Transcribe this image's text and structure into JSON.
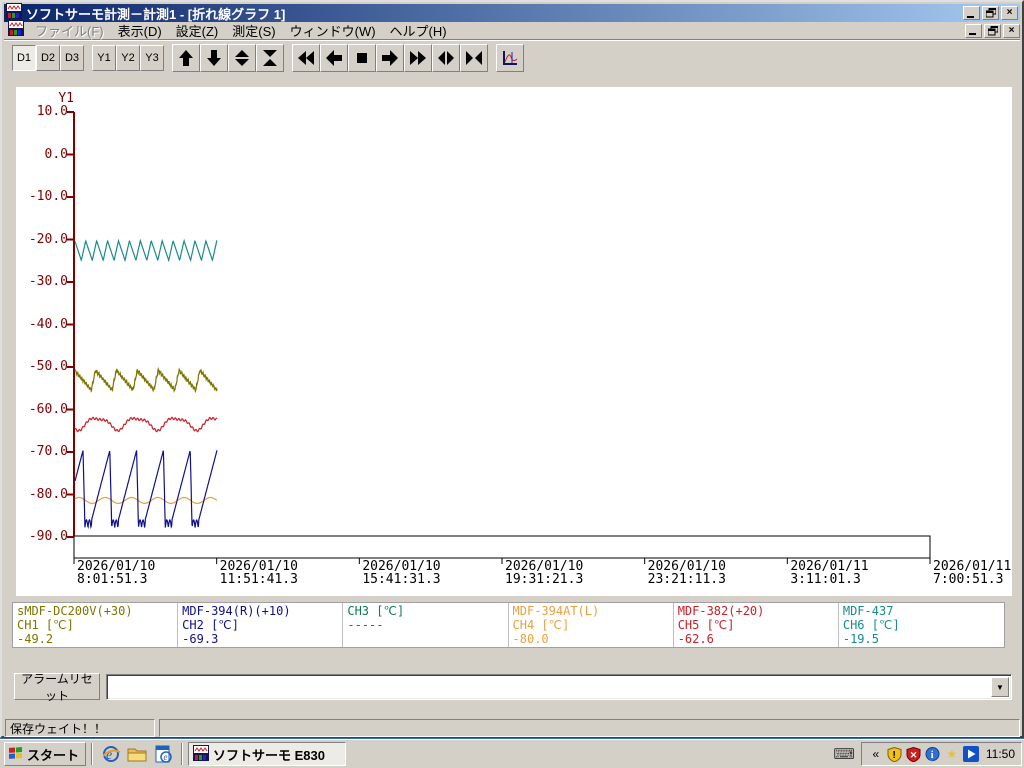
{
  "window": {
    "title": "ソフトサーモ計測－計測1 - [折れ線グラフ 1]"
  },
  "menu": {
    "items": [
      {
        "label": "ファイル(F)",
        "enabled": false
      },
      {
        "label": "表示(D)",
        "enabled": true
      },
      {
        "label": "設定(Z)",
        "enabled": true
      },
      {
        "label": "測定(S)",
        "enabled": true
      },
      {
        "label": "ウィンドウ(W)",
        "enabled": true
      },
      {
        "label": "ヘルプ(H)",
        "enabled": true
      }
    ]
  },
  "toolbar": {
    "display_buttons": [
      "D1",
      "D2",
      "D3"
    ],
    "active_display": "D1",
    "axis_buttons": [
      "Y1",
      "Y2",
      "Y3"
    ],
    "icon_buttons": [
      "scroll-up",
      "scroll-down",
      "expand-vertical",
      "compress-vertical",
      "fast-rewind",
      "scroll-left",
      "stop",
      "scroll-right",
      "fast-forward",
      "expand-horizontal",
      "compress-horizontal",
      "graph-settings"
    ]
  },
  "chart_data": {
    "type": "line",
    "y_axis": {
      "label": "Y1",
      "min": -90,
      "max": 10,
      "tick_step": 10,
      "tick_labels": [
        "10.0",
        "0.0",
        "-10.0",
        "-20.0",
        "-30.0",
        "-40.0",
        "-50.0",
        "-60.0",
        "-70.0",
        "-80.0",
        "-90.0"
      ],
      "color": "#800000"
    },
    "x_axis": {
      "ticks": [
        {
          "date": "2026/01/10",
          "time": "8:01:51.3"
        },
        {
          "date": "2026/01/10",
          "time": "11:51:41.3"
        },
        {
          "date": "2026/01/10",
          "time": "15:41:31.3"
        },
        {
          "date": "2026/01/10",
          "time": "19:31:21.3"
        },
        {
          "date": "2026/01/10",
          "time": "23:21:11.3"
        },
        {
          "date": "2026/01/11",
          "time": "3:11:01.3"
        },
        {
          "date": "2026/01/11",
          "time": "7:00:51.3"
        }
      ]
    },
    "data_extent_frac": 0.166,
    "series": [
      {
        "channel_label": "CH1 [℃]",
        "name": "sMDF-DC200V(+30)",
        "value": "-49.2",
        "color": "#7B7500",
        "waveform": {
          "shape": "saw_fall",
          "max": -50.8,
          "min": -55.4,
          "cycles": 6.8,
          "phase": 0.02,
          "noise": 0.3
        }
      },
      {
        "channel_label": "CH2 [℃]",
        "name": "MDF-394(R)(+10)",
        "value": "-69.3",
        "color": "#10108C",
        "waveform": {
          "shape": "ramp_crash",
          "max": -69.6,
          "min": -87.8,
          "cycles": 5.3,
          "phase": 0.7
        }
      },
      {
        "channel_label": "CH3 [℃]",
        "name": "",
        "value": "-----",
        "color": "#0E7A50",
        "waveform": null
      },
      {
        "channel_label": "CH4 [℃]",
        "name": "MDF-394AT(L)",
        "value": "-80.0",
        "color": "#E8A040",
        "waveform": {
          "shape": "sine",
          "max": -80.7,
          "min": -82.1,
          "cycles": 5.4,
          "phase": 0.1
        }
      },
      {
        "channel_label": "CH5 [℃]",
        "name": "MDF-382(+20)",
        "value": "-62.6",
        "color": "#C82028",
        "waveform": {
          "shape": "sine_noisy",
          "max": -61.4,
          "min": -65.0,
          "cycles": 3.6,
          "phase": 0.68,
          "noise": 0.25
        }
      },
      {
        "channel_label": "CH6 [℃]",
        "name": "MDF-437",
        "value": "-19.5",
        "color": "#178A8A",
        "waveform": {
          "shape": "zigzag",
          "max": -20.3,
          "min": -24.9,
          "cycles": 13,
          "phase": 0.42
        }
      }
    ]
  },
  "alarm": {
    "reset_label": "アラームリセット",
    "combo_value": ""
  },
  "status": {
    "message": "保存ウェイト！！"
  },
  "taskbar": {
    "start_label": "スタート",
    "task_label": "ソフトサーモ  E830",
    "clock": "11:50",
    "tray_chevron": "«"
  }
}
